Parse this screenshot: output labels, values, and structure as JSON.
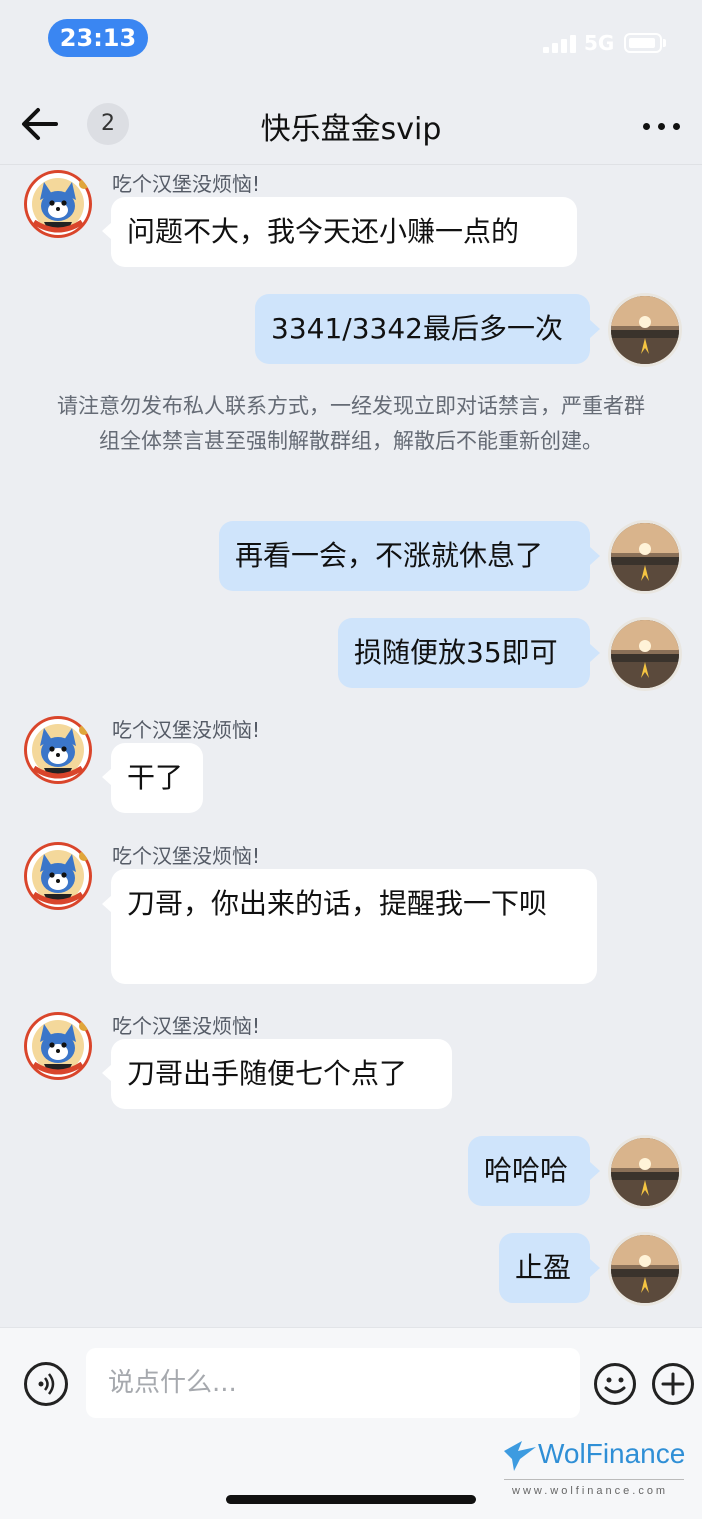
{
  "status_bar": {
    "time": "23:13",
    "network": "5G"
  },
  "nav": {
    "unread_count": "2",
    "title": "快乐盘金svip",
    "back_icon": "arrow-left-icon",
    "more_icon": "more-dots-icon"
  },
  "messages": [
    {
      "side": "other",
      "sender": "吃个汉堡没烦恼!",
      "text": "问题不大，我今天还小赚一点的"
    },
    {
      "side": "self",
      "text": "3341/3342最后多一次"
    },
    {
      "side": "system",
      "text": "请注意勿发布私人联系方式，一经发现立即对话禁言，严重者群组全体禁言甚至强制解散群组，解散后不能重新创建。"
    },
    {
      "side": "self",
      "text": "再看一会，不涨就休息了"
    },
    {
      "side": "self",
      "text": "损随便放35即可"
    },
    {
      "side": "other",
      "sender": "吃个汉堡没烦恼!",
      "text": "干了"
    },
    {
      "side": "other",
      "sender": "吃个汉堡没烦恼!",
      "text": "刀哥，你出来的话，提醒我一下呗"
    },
    {
      "side": "other",
      "sender": "吃个汉堡没烦恼!",
      "text": "刀哥出手随便七个点了"
    },
    {
      "side": "self",
      "text": "哈哈哈"
    },
    {
      "side": "self",
      "text": "止盈"
    }
  ],
  "input_bar": {
    "placeholder": "说点什么...",
    "voice_icon": "voice-icon",
    "emoji_icon": "emoji-icon",
    "plus_icon": "plus-icon"
  },
  "watermark": {
    "brand": "WolFinance",
    "url": "www.wolfinance.com"
  },
  "colors": {
    "accent": "#3a86f2",
    "self_bubble": "#cfe4fb",
    "other_bubble": "#ffffff",
    "background": "#eceef2"
  }
}
